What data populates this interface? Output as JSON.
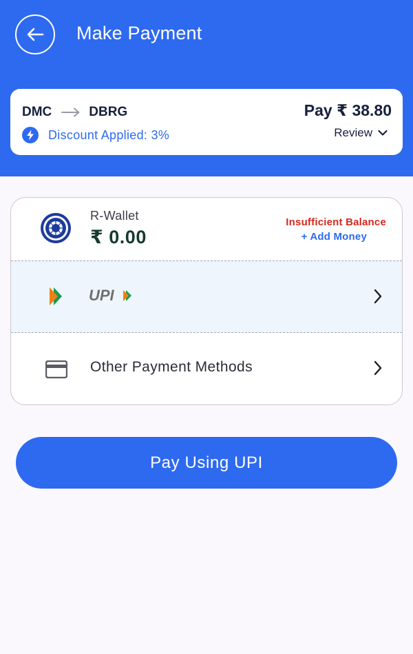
{
  "header": {
    "title": "Make Payment"
  },
  "summary": {
    "from": "DMC",
    "to": "DBRG",
    "pay_text": "Pay ₹ 38.80",
    "discount_text": "Discount Applied: 3%",
    "review_label": "Review"
  },
  "wallet": {
    "label": "R-Wallet",
    "balance": "₹ 0.00",
    "status": "Insufficient Balance",
    "add_money": "+ Add Money"
  },
  "upi": {
    "logo_text": "UPI"
  },
  "other": {
    "label": "Other Payment Methods"
  },
  "pay_button": {
    "label": "Pay Using UPI"
  },
  "colors": {
    "primary": "#2e6af0",
    "error": "#d12a1f",
    "balance": "#163a2f",
    "background": "#fbf8fd"
  }
}
